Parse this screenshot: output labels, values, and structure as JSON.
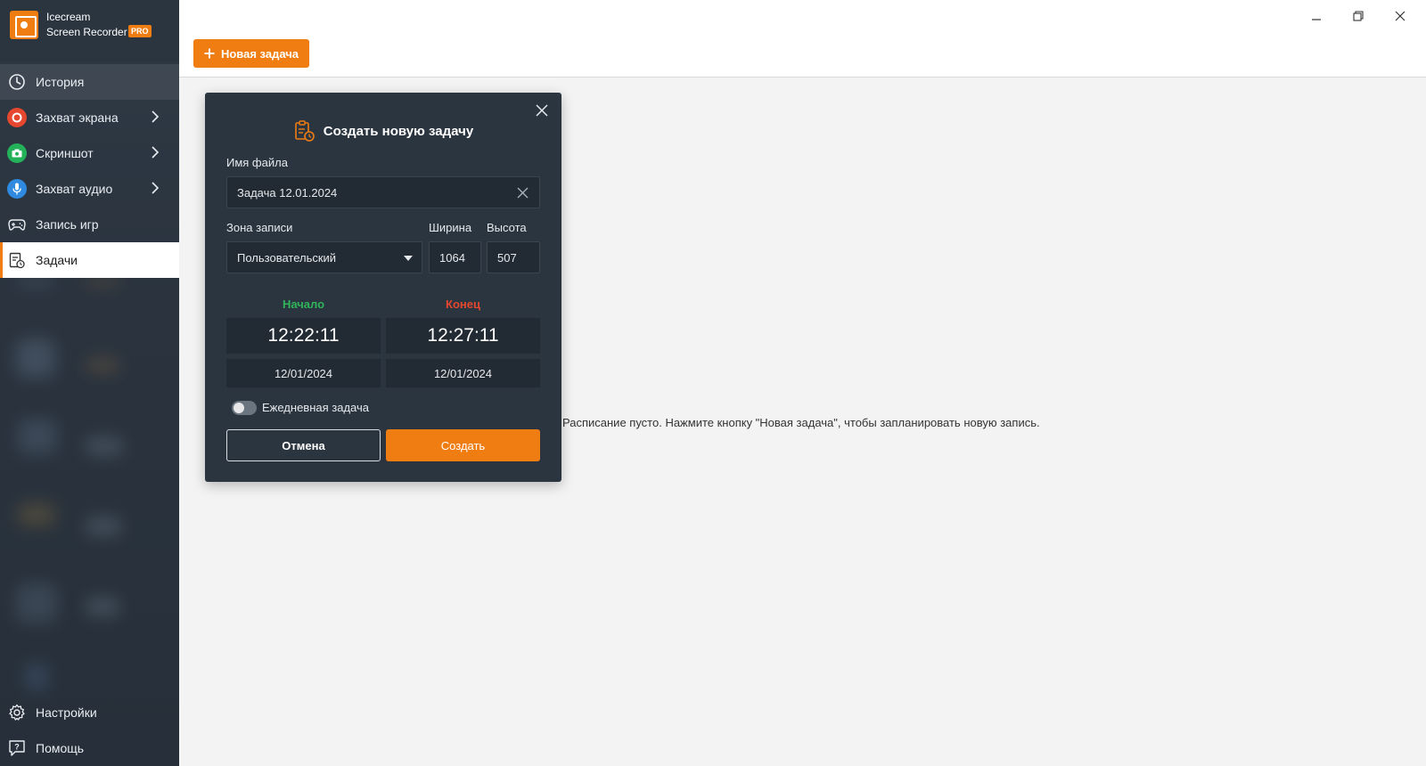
{
  "app": {
    "name_line1": "Icecream",
    "name_line2": "Screen Recorder",
    "badge": "PRO",
    "accent": "#f07d12"
  },
  "sidebar": {
    "items": [
      {
        "label": "История",
        "icon": "clock-icon"
      },
      {
        "label": "Захват экрана",
        "icon": "record-icon",
        "color": "#e5472f"
      },
      {
        "label": "Скриншот",
        "icon": "camera-icon",
        "color": "#23b25a"
      },
      {
        "label": "Захват аудио",
        "icon": "microphone-icon",
        "color": "#2f8ae0"
      },
      {
        "label": "Запись игр",
        "icon": "gamepad-icon"
      },
      {
        "label": "Задачи",
        "icon": "tasks-icon",
        "active": true
      }
    ],
    "bottom": [
      {
        "label": "Настройки",
        "icon": "gear-icon"
      },
      {
        "label": "Помощь",
        "icon": "help-icon"
      }
    ]
  },
  "toolbar": {
    "new_task_label": "Новая задача"
  },
  "main": {
    "empty_message": "Расписание пусто. Нажмите кнопку \"Новая задача\", чтобы запланировать новую запись."
  },
  "dialog": {
    "title": "Создать новую задачу",
    "filename_label": "Имя файла",
    "filename_value": "Задача 12.01.2024",
    "zone_label": "Зона записи",
    "zone_value": "Пользовательский",
    "width_label": "Ширина",
    "width_value": "1064",
    "height_label": "Высота",
    "height_value": "507",
    "start_label": "Начало",
    "start_color": "#2fb45a",
    "start_time": "12:22:11",
    "start_date": "12/01/2024",
    "end_label": "Конец",
    "end_color": "#e5472f",
    "end_time": "12:27:11",
    "end_date": "12/01/2024",
    "daily_label": "Ежедневная задача",
    "daily_enabled": false,
    "cancel_label": "Отмена",
    "create_label": "Создать"
  }
}
